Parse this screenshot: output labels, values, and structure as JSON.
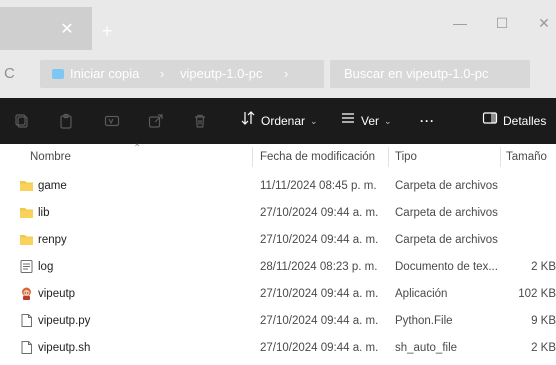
{
  "window": {
    "tab_close_glyph": "✕",
    "new_tab_glyph": "+",
    "minimize_glyph": "—",
    "maximize_glyph": "☐",
    "close_glyph": "✕"
  },
  "address": {
    "refresh_glyph": "C",
    "breadcrumb": [
      "Iniciar copia",
      "vipeutp-1.0-pc"
    ],
    "separator": "›",
    "search_placeholder": "Buscar en vipeutp-1.0-pc"
  },
  "toolbar": {
    "sort_label": "Ordenar",
    "view_label": "Ver",
    "more_label": "···",
    "details_label": "Detalles"
  },
  "columns": {
    "name": "Nombre",
    "date": "Fecha de modificación",
    "type": "Tipo",
    "size": "Tamaño"
  },
  "files": [
    {
      "name": "game",
      "date": "11/11/2024 08:45 p. m.",
      "type": "Carpeta de archivos",
      "size": "",
      "icon": "folder-icon"
    },
    {
      "name": "lib",
      "date": "27/10/2024 09:44 a. m.",
      "type": "Carpeta de archivos",
      "size": "",
      "icon": "folder-icon"
    },
    {
      "name": "renpy",
      "date": "27/10/2024 09:44 a. m.",
      "type": "Carpeta de archivos",
      "size": "",
      "icon": "folder-icon"
    },
    {
      "name": "log",
      "date": "28/11/2024 08:23 p. m.",
      "type": "Documento de tex...",
      "size": "2 KB",
      "icon": "text-document-icon"
    },
    {
      "name": "vipeutp",
      "date": "27/10/2024 09:44 a. m.",
      "type": "Aplicación",
      "size": "102 KB",
      "icon": "application-icon"
    },
    {
      "name": "vipeutp.py",
      "date": "27/10/2024 09:44 a. m.",
      "type": "Python.File",
      "size": "9 KB",
      "icon": "file-icon"
    },
    {
      "name": "vipeutp.sh",
      "date": "27/10/2024 09:44 a. m.",
      "type": "sh_auto_file",
      "size": "2 KB",
      "icon": "file-icon"
    }
  ],
  "colors": {
    "folder": "#f2c84b",
    "command_bar": "#1b1b1b",
    "titlebar": "#e9e9e9"
  }
}
